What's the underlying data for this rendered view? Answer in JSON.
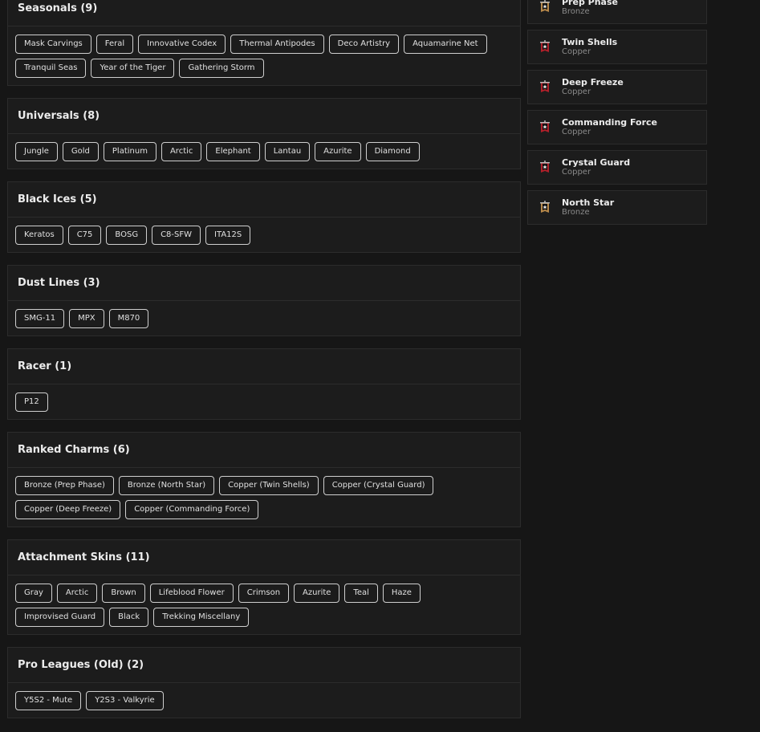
{
  "sections": [
    {
      "title": "Seasonals (9)",
      "items": [
        "Mask Carvings",
        "Feral",
        "Innovative Codex",
        "Thermal Antipodes",
        "Deco Artistry",
        "Aquamarine Net",
        "Tranquil Seas",
        "Year of the Tiger",
        "Gathering Storm"
      ]
    },
    {
      "title": "Universals (8)",
      "items": [
        "Jungle",
        "Gold",
        "Platinum",
        "Arctic",
        "Elephant",
        "Lantau",
        "Azurite",
        "Diamond"
      ]
    },
    {
      "title": "Black Ices (5)",
      "items": [
        "Keratos",
        "C75",
        "BOSG",
        "C8-SFW",
        "ITA12S"
      ]
    },
    {
      "title": "Dust Lines (3)",
      "items": [
        "SMG-11",
        "MPX",
        "M870"
      ]
    },
    {
      "title": "Racer (1)",
      "items": [
        "P12"
      ]
    },
    {
      "title": "Ranked Charms (6)",
      "items": [
        "Bronze (Prep Phase)",
        "Bronze (North Star)",
        "Copper (Twin Shells)",
        "Copper (Crystal Guard)",
        "Copper (Deep Freeze)",
        "Copper (Commanding Force)"
      ]
    },
    {
      "title": "Attachment Skins (11)",
      "items": [
        "Gray",
        "Arctic",
        "Brown",
        "Lifeblood Flower",
        "Crimson",
        "Azurite",
        "Teal",
        "Haze",
        "Improvised Guard",
        "Black",
        "Trekking Miscellany"
      ]
    },
    {
      "title": "Pro Leagues (Old) (2)",
      "items": [
        "Y5S2 - Mute",
        "Y2S3 - Valkyrie"
      ]
    }
  ],
  "ranks": [
    {
      "name": "Prep Phase",
      "tier": "Bronze",
      "color": "#b8894a"
    },
    {
      "name": "Twin Shells",
      "tier": "Copper",
      "color": "#b0202a"
    },
    {
      "name": "Deep Freeze",
      "tier": "Copper",
      "color": "#b0202a"
    },
    {
      "name": "Commanding Force",
      "tier": "Copper",
      "color": "#b0202a"
    },
    {
      "name": "Crystal Guard",
      "tier": "Copper",
      "color": "#b0202a"
    },
    {
      "name": "North Star",
      "tier": "Bronze",
      "color": "#b8894a"
    }
  ]
}
